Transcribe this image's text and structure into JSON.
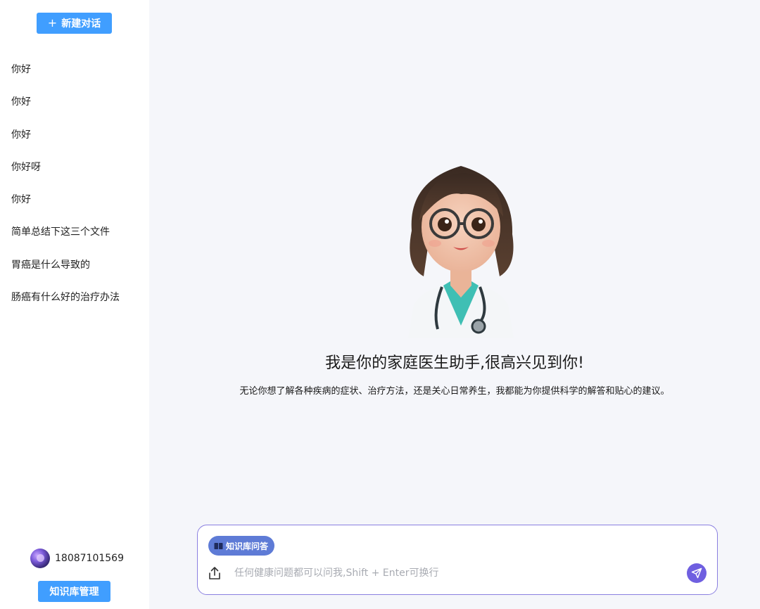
{
  "sidebar": {
    "new_chat_label": "新建对话",
    "history": [
      "你好",
      "你好",
      "你好",
      "你好呀",
      "你好",
      "简单总结下这三个文件",
      "胃癌是什么导致的",
      "肠癌有什么好的治疗办法"
    ],
    "user_name": "18087101569",
    "kb_manage_label": "知识库管理"
  },
  "main": {
    "welcome_title": "我是你的家庭医生助手,很高兴见到你!",
    "welcome_subtitle": "无论你想了解各种疾病的症状、治疗方法，还是关心日常养生，我都能为你提供科学的解答和贴心的建议。",
    "input": {
      "kb_tag_label": "知识库问答",
      "placeholder": "任何健康问题都可以问我,Shift + Enter可换行",
      "value": ""
    }
  },
  "colors": {
    "primary_button": "#409eff",
    "main_background": "#f5f6fa",
    "input_border": "#8a7fe0",
    "kb_tag": "#5e7bd6",
    "send_button": "#6f5fe0"
  },
  "icons": {
    "new_chat": "plus-icon",
    "kb_tag": "book-icon",
    "upload": "upload-icon",
    "send": "paper-plane-icon",
    "avatar": "user-avatar"
  }
}
